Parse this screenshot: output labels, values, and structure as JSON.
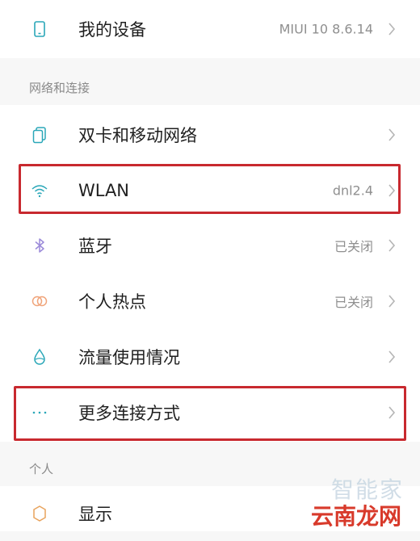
{
  "device": {
    "label": "我的设备",
    "value": "MIUI 10 8.6.14",
    "icon": "phone-icon"
  },
  "network_section": {
    "title": "网络和连接",
    "items": [
      {
        "label": "双卡和移动网络",
        "value": "",
        "icon": "dual-sim-icon"
      },
      {
        "label": "WLAN",
        "value": "dnl2.4",
        "icon": "wifi-icon"
      },
      {
        "label": "蓝牙",
        "value": "已关闭",
        "icon": "bluetooth-icon"
      },
      {
        "label": "个人热点",
        "value": "已关闭",
        "icon": "hotspot-icon"
      },
      {
        "label": "流量使用情况",
        "value": "",
        "icon": "data-usage-icon"
      },
      {
        "label": "更多连接方式",
        "value": "",
        "icon": "more-icon"
      }
    ]
  },
  "personal_section": {
    "title": "个人",
    "items": [
      {
        "label": "显示",
        "value": "",
        "icon": "display-icon"
      }
    ]
  },
  "watermark": {
    "line1": "智能家",
    "line2": "云南龙网"
  },
  "colors": {
    "accent": "#2aa7b8",
    "highlight": "#c8292f",
    "bluetooth": "#9b8ad9",
    "hotspot": "#f0a47a",
    "display": "#e8a35c"
  }
}
